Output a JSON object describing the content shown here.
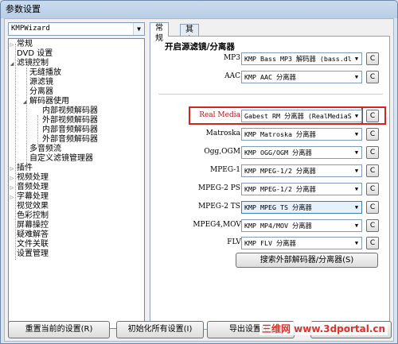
{
  "window": {
    "title": "参数设置"
  },
  "profile": {
    "value": "KMPWizard"
  },
  "tree": [
    {
      "label": "常规",
      "expander": "▷"
    },
    {
      "label": "DVD 设置",
      "expander": ""
    },
    {
      "label": "滤镜控制",
      "expander": "◢"
    },
    {
      "label": "无缝播放",
      "expander": ""
    },
    {
      "label": "源滤镜",
      "expander": ""
    },
    {
      "label": "分离器",
      "expander": ""
    },
    {
      "label": "解码器使用",
      "expander": "◢"
    },
    {
      "label": "内部视频解码器",
      "expander": ""
    },
    {
      "label": "外部视频解码器",
      "expander": ""
    },
    {
      "label": "内部音频解码器",
      "expander": ""
    },
    {
      "label": "外部音频解码器",
      "expander": ""
    },
    {
      "label": "多音频流",
      "expander": ""
    },
    {
      "label": "自定义滤镜管理器",
      "expander": ""
    },
    {
      "label": "插件",
      "expander": "▷"
    },
    {
      "label": "视频处理",
      "expander": "▷"
    },
    {
      "label": "音频处理",
      "expander": "▷"
    },
    {
      "label": "字幕处理",
      "expander": "▷"
    },
    {
      "label": "视觉效果",
      "expander": ""
    },
    {
      "label": "色彩控制",
      "expander": ""
    },
    {
      "label": "屏幕操控",
      "expander": ""
    },
    {
      "label": "疑难解答",
      "expander": ""
    },
    {
      "label": "文件关联",
      "expander": ""
    },
    {
      "label": "设置管理",
      "expander": ""
    }
  ],
  "tabs": [
    {
      "label": "常规"
    },
    {
      "label": "其它"
    }
  ],
  "panel": {
    "section_title": "开启源滤镜/分离器",
    "rows": [
      {
        "label": "MP3:",
        "value": "KMP Bass MP3 解码器 (bass.dl",
        "button": "C"
      },
      {
        "label": "AAC:",
        "value": "KMP AAC 分离器",
        "button": "C"
      },
      {
        "label": "Real Media:",
        "value": "Gabest RM 分离器 (RealMediaS",
        "button": "C"
      },
      {
        "label": "Matroska:",
        "value": "KMP Matroska 分离器",
        "button": "C"
      },
      {
        "label": "Ogg,OGM:",
        "value": "KMP OGG/OGM 分离器",
        "button": "C"
      },
      {
        "label": "MPEG-1:",
        "value": "KMP MPEG-1/2 分离器",
        "button": "C"
      },
      {
        "label": "MPEG-2 PS:",
        "value": "KMP MPEG-1/2 分离器",
        "button": "C"
      },
      {
        "label": "MPEG-2 TS:",
        "value": "KMP MPEG TS 分离器",
        "button": "C"
      },
      {
        "label": "MPEG4,MOV:",
        "value": "KMP MP4/MOV 分离器",
        "button": "C"
      },
      {
        "label": "FLV:",
        "value": "KMP FLV 分离器",
        "button": "C"
      }
    ],
    "search_button": "搜索外部解码器/分离器(S)"
  },
  "bottom": {
    "reset": "重置当前的设置(R)",
    "init_all": "初始化所有设置(I)",
    "export": "导出设置(E)",
    "close": "关闭(C)"
  },
  "watermark": "三维网 www.3dportal.cn",
  "colors": {
    "highlight": "#d42323",
    "watermark": "#d8342b"
  }
}
